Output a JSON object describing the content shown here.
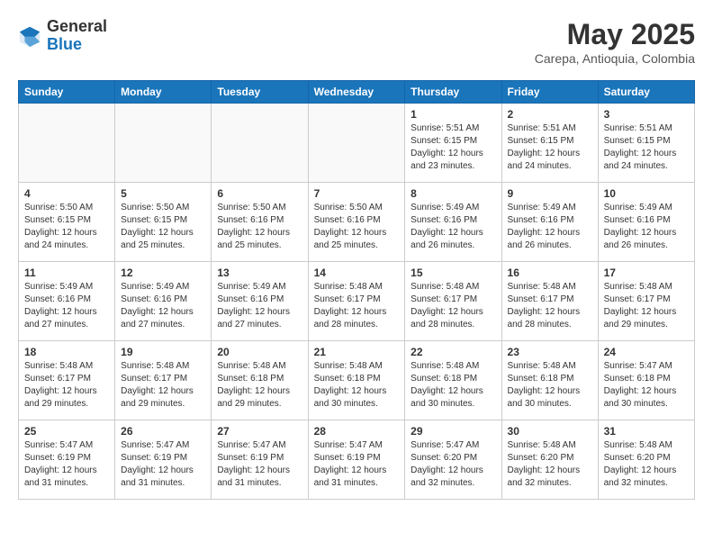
{
  "header": {
    "logo_line1": "General",
    "logo_line2": "Blue",
    "month_year": "May 2025",
    "location": "Carepa, Antioquia, Colombia"
  },
  "weekdays": [
    "Sunday",
    "Monday",
    "Tuesday",
    "Wednesday",
    "Thursday",
    "Friday",
    "Saturday"
  ],
  "weeks": [
    [
      {
        "day": "",
        "info": ""
      },
      {
        "day": "",
        "info": ""
      },
      {
        "day": "",
        "info": ""
      },
      {
        "day": "",
        "info": ""
      },
      {
        "day": "1",
        "info": "Sunrise: 5:51 AM\nSunset: 6:15 PM\nDaylight: 12 hours\nand 23 minutes."
      },
      {
        "day": "2",
        "info": "Sunrise: 5:51 AM\nSunset: 6:15 PM\nDaylight: 12 hours\nand 24 minutes."
      },
      {
        "day": "3",
        "info": "Sunrise: 5:51 AM\nSunset: 6:15 PM\nDaylight: 12 hours\nand 24 minutes."
      }
    ],
    [
      {
        "day": "4",
        "info": "Sunrise: 5:50 AM\nSunset: 6:15 PM\nDaylight: 12 hours\nand 24 minutes."
      },
      {
        "day": "5",
        "info": "Sunrise: 5:50 AM\nSunset: 6:15 PM\nDaylight: 12 hours\nand 25 minutes."
      },
      {
        "day": "6",
        "info": "Sunrise: 5:50 AM\nSunset: 6:16 PM\nDaylight: 12 hours\nand 25 minutes."
      },
      {
        "day": "7",
        "info": "Sunrise: 5:50 AM\nSunset: 6:16 PM\nDaylight: 12 hours\nand 25 minutes."
      },
      {
        "day": "8",
        "info": "Sunrise: 5:49 AM\nSunset: 6:16 PM\nDaylight: 12 hours\nand 26 minutes."
      },
      {
        "day": "9",
        "info": "Sunrise: 5:49 AM\nSunset: 6:16 PM\nDaylight: 12 hours\nand 26 minutes."
      },
      {
        "day": "10",
        "info": "Sunrise: 5:49 AM\nSunset: 6:16 PM\nDaylight: 12 hours\nand 26 minutes."
      }
    ],
    [
      {
        "day": "11",
        "info": "Sunrise: 5:49 AM\nSunset: 6:16 PM\nDaylight: 12 hours\nand 27 minutes."
      },
      {
        "day": "12",
        "info": "Sunrise: 5:49 AM\nSunset: 6:16 PM\nDaylight: 12 hours\nand 27 minutes."
      },
      {
        "day": "13",
        "info": "Sunrise: 5:49 AM\nSunset: 6:16 PM\nDaylight: 12 hours\nand 27 minutes."
      },
      {
        "day": "14",
        "info": "Sunrise: 5:48 AM\nSunset: 6:17 PM\nDaylight: 12 hours\nand 28 minutes."
      },
      {
        "day": "15",
        "info": "Sunrise: 5:48 AM\nSunset: 6:17 PM\nDaylight: 12 hours\nand 28 minutes."
      },
      {
        "day": "16",
        "info": "Sunrise: 5:48 AM\nSunset: 6:17 PM\nDaylight: 12 hours\nand 28 minutes."
      },
      {
        "day": "17",
        "info": "Sunrise: 5:48 AM\nSunset: 6:17 PM\nDaylight: 12 hours\nand 29 minutes."
      }
    ],
    [
      {
        "day": "18",
        "info": "Sunrise: 5:48 AM\nSunset: 6:17 PM\nDaylight: 12 hours\nand 29 minutes."
      },
      {
        "day": "19",
        "info": "Sunrise: 5:48 AM\nSunset: 6:17 PM\nDaylight: 12 hours\nand 29 minutes."
      },
      {
        "day": "20",
        "info": "Sunrise: 5:48 AM\nSunset: 6:18 PM\nDaylight: 12 hours\nand 29 minutes."
      },
      {
        "day": "21",
        "info": "Sunrise: 5:48 AM\nSunset: 6:18 PM\nDaylight: 12 hours\nand 30 minutes."
      },
      {
        "day": "22",
        "info": "Sunrise: 5:48 AM\nSunset: 6:18 PM\nDaylight: 12 hours\nand 30 minutes."
      },
      {
        "day": "23",
        "info": "Sunrise: 5:48 AM\nSunset: 6:18 PM\nDaylight: 12 hours\nand 30 minutes."
      },
      {
        "day": "24",
        "info": "Sunrise: 5:47 AM\nSunset: 6:18 PM\nDaylight: 12 hours\nand 30 minutes."
      }
    ],
    [
      {
        "day": "25",
        "info": "Sunrise: 5:47 AM\nSunset: 6:19 PM\nDaylight: 12 hours\nand 31 minutes."
      },
      {
        "day": "26",
        "info": "Sunrise: 5:47 AM\nSunset: 6:19 PM\nDaylight: 12 hours\nand 31 minutes."
      },
      {
        "day": "27",
        "info": "Sunrise: 5:47 AM\nSunset: 6:19 PM\nDaylight: 12 hours\nand 31 minutes."
      },
      {
        "day": "28",
        "info": "Sunrise: 5:47 AM\nSunset: 6:19 PM\nDaylight: 12 hours\nand 31 minutes."
      },
      {
        "day": "29",
        "info": "Sunrise: 5:47 AM\nSunset: 6:20 PM\nDaylight: 12 hours\nand 32 minutes."
      },
      {
        "day": "30",
        "info": "Sunrise: 5:48 AM\nSunset: 6:20 PM\nDaylight: 12 hours\nand 32 minutes."
      },
      {
        "day": "31",
        "info": "Sunrise: 5:48 AM\nSunset: 6:20 PM\nDaylight: 12 hours\nand 32 minutes."
      }
    ]
  ]
}
